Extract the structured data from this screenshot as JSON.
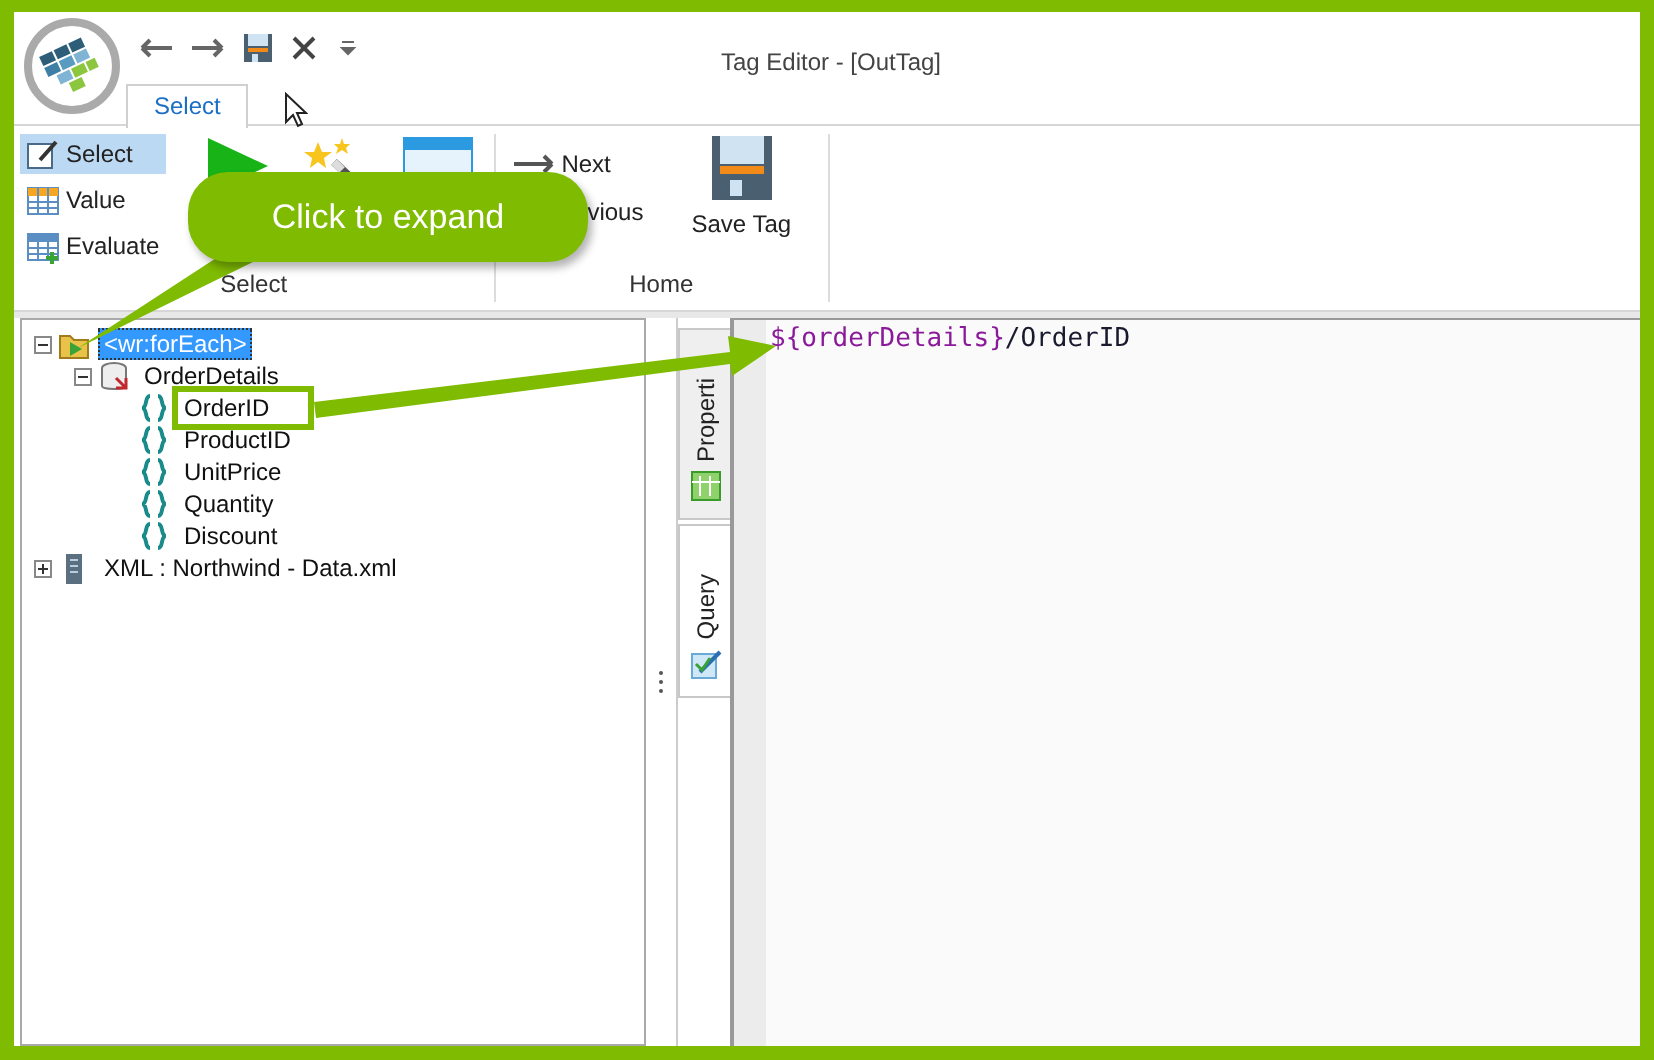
{
  "window": {
    "title": "Tag Editor - [OutTag]"
  },
  "ribbon_tabs": [
    {
      "label": "Select",
      "selected": true
    }
  ],
  "ribbon_groups": [
    {
      "label": "Select",
      "small_buttons": [
        {
          "label": "Select",
          "kind": "select",
          "selected": true
        },
        {
          "label": "Value",
          "kind": "value",
          "selected": false
        },
        {
          "label": "Evaluate",
          "kind": "evaluate",
          "selected": false
        }
      ],
      "large_buttons": [
        {
          "kind": "run"
        },
        {
          "kind": "wand"
        },
        {
          "kind": "window"
        }
      ]
    },
    {
      "label": "Home",
      "nav_buttons": [
        {
          "label": "Next",
          "kind": "next"
        },
        {
          "label": "vious",
          "kind": "previous"
        }
      ],
      "large_buttons": [
        {
          "kind": "save",
          "label": "Save Tag"
        }
      ]
    }
  ],
  "tree": [
    {
      "label": "<wr:forEach>",
      "kind": "foreach",
      "expanded": true,
      "selected": true,
      "children": [
        {
          "label": "OrderDetails",
          "kind": "datasource",
          "expanded": true,
          "selected": false,
          "children": [
            {
              "label": "OrderID",
              "kind": "field",
              "selected": false,
              "highlighted": true
            },
            {
              "label": "ProductID",
              "kind": "field",
              "selected": false,
              "highlighted": false
            },
            {
              "label": "UnitPrice",
              "kind": "field",
              "selected": false,
              "highlighted": false
            },
            {
              "label": "Quantity",
              "kind": "field",
              "selected": false,
              "highlighted": false
            },
            {
              "label": "Discount",
              "kind": "field",
              "selected": false,
              "highlighted": false
            }
          ]
        }
      ]
    },
    {
      "label": "XML : Northwind - Data.xml",
      "kind": "xml",
      "expanded": false,
      "selected": false
    }
  ],
  "side_tabs": [
    {
      "label": "Properti",
      "kind": "properties",
      "selected": false
    },
    {
      "label": "Query",
      "kind": "query",
      "selected": true
    }
  ],
  "editor": {
    "tokens": [
      {
        "text": "${orderDetails}",
        "kind": "variable"
      },
      {
        "text": "/OrderID",
        "kind": "plain"
      }
    ]
  },
  "callout": {
    "text": "Click to expand"
  }
}
